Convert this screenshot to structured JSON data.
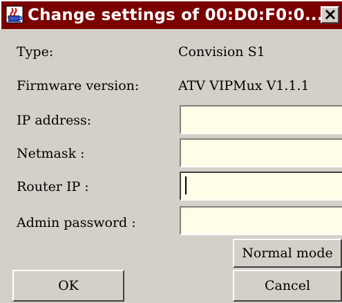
{
  "window": {
    "title": "Change settings of 00:D0:F0:0...",
    "icon": "java-cup-icon",
    "close_glyph": "✕"
  },
  "info": {
    "type_label": "Type:",
    "type_value": "Convision S1",
    "firmware_label": "Firmware version:",
    "firmware_value": "ATV VIPMux V1.1.1"
  },
  "form": {
    "ip_label": "IP address:",
    "ip_value": "",
    "netmask_label": "Netmask :",
    "netmask_value": "",
    "router_label": "Router IP :",
    "router_value": "",
    "admin_label": "Admin password :",
    "admin_value": ""
  },
  "buttons": {
    "normal_mode": "Normal mode",
    "ok": "OK",
    "cancel": "Cancel"
  },
  "colors": {
    "titlebar": "#7b0000",
    "field_bg": "#fefde8",
    "face": "#d4d0c8"
  }
}
